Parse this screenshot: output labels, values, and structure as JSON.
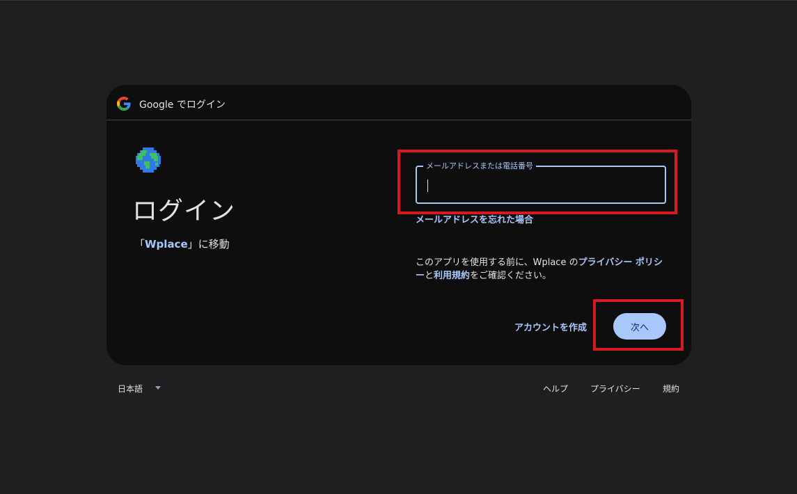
{
  "header": {
    "title": "Google でログイン",
    "logo_icon": "google-g-icon"
  },
  "app": {
    "icon": "globe-icon",
    "name": "Wplace"
  },
  "page": {
    "title": "ログイン",
    "subtitle_prefix": "「",
    "subtitle_app": "Wplace",
    "subtitle_suffix": "」に移動"
  },
  "login": {
    "email_label": "メールアドレスまたは電話番号",
    "email_value": "",
    "forgot_email": "メールアドレスを忘れた場合",
    "notice_before": "このアプリを使用する前に、Wplace の",
    "privacy_link": "プライバシー ポリシー",
    "notice_and": "と",
    "terms_link": "利用規約",
    "notice_after": "をご確認ください。",
    "create_account": "アカウントを作成",
    "next": "次へ"
  },
  "footer": {
    "language": "日本語",
    "help": "ヘルプ",
    "privacy": "プライバシー",
    "terms": "規約"
  },
  "colors": {
    "background": "#1f1f21",
    "card": "#0e0e0f",
    "accent": "#a8c7fa",
    "highlight": "#d71a22"
  }
}
